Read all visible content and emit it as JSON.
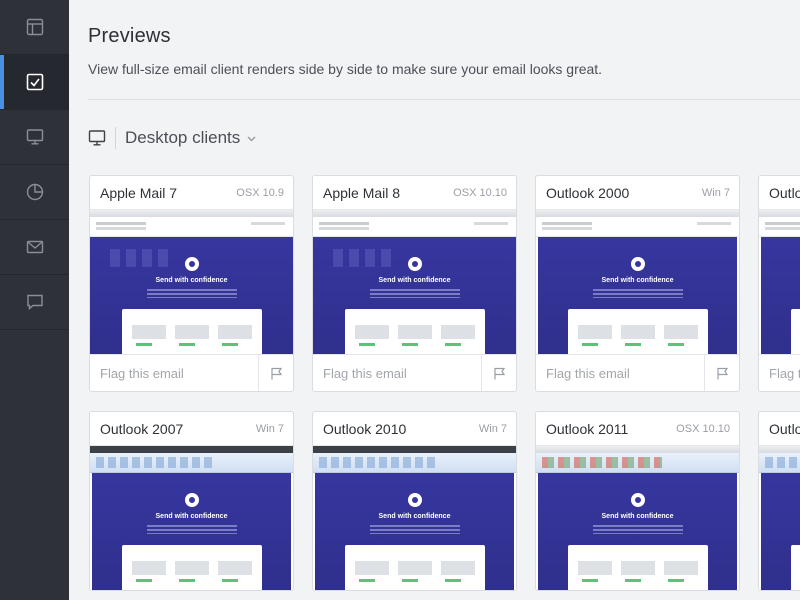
{
  "sidebar": {
    "items": [
      {
        "name": "layout-icon",
        "active": false
      },
      {
        "name": "checklist-icon",
        "active": true
      },
      {
        "name": "monitor-icon",
        "active": false
      },
      {
        "name": "pie-chart-icon",
        "active": false
      },
      {
        "name": "mail-icon",
        "active": false
      },
      {
        "name": "chat-icon",
        "active": false
      }
    ]
  },
  "page": {
    "title": "Previews",
    "description": "View full-size email client renders side by side to make sure your email looks great."
  },
  "section": {
    "title": "Desktop clients",
    "icon": "monitor-icon",
    "dropdown_icon": "chevron-down-icon"
  },
  "cards": [
    {
      "name": "Apple Mail 7",
      "os": "OSX 10.9",
      "flag_label": "Flag this email",
      "style": "mac"
    },
    {
      "name": "Apple Mail 8",
      "os": "OSX 10.10",
      "flag_label": "Flag this email",
      "style": "mac"
    },
    {
      "name": "Outlook 2000",
      "os": "Win 7",
      "flag_label": "Flag this email",
      "style": "win"
    },
    {
      "name": "Outlo",
      "os": "",
      "flag_label": "Flag t",
      "style": "win"
    },
    {
      "name": "Outlook 2007",
      "os": "Win 7",
      "flag_label": "",
      "style": "ribbon-dark"
    },
    {
      "name": "Outlook 2010",
      "os": "Win 7",
      "flag_label": "",
      "style": "ribbon-dark"
    },
    {
      "name": "Outlook 2011",
      "os": "OSX 10.10",
      "flag_label": "",
      "style": "ribbon-office"
    },
    {
      "name": "Outlo",
      "os": "",
      "flag_label": "",
      "style": "ribbon"
    }
  ],
  "email_preview": {
    "headline": "Send with confidence"
  },
  "colors": {
    "sidebar_bg": "#2e3138",
    "active_accent": "#4a90e2",
    "email_bg": "#37369f"
  }
}
